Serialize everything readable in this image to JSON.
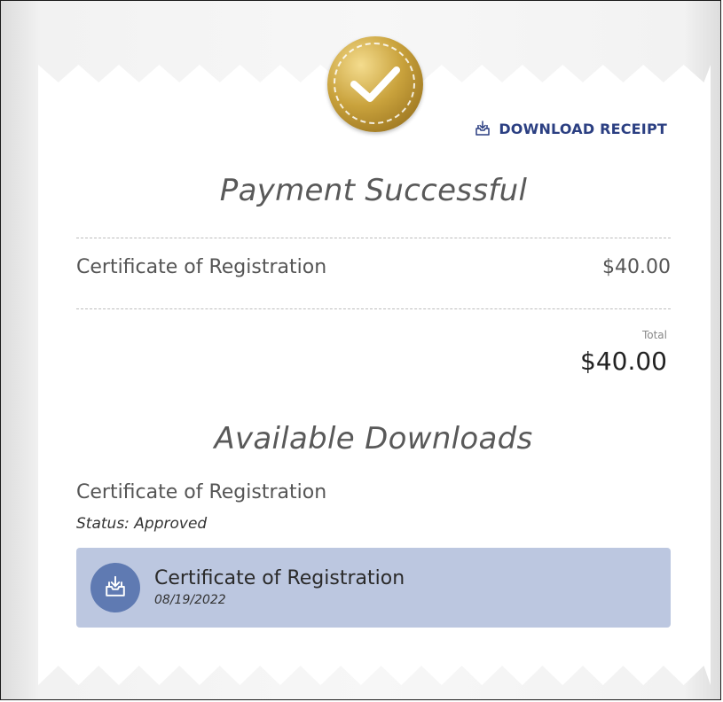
{
  "actions": {
    "download_receipt": "DOWNLOAD RECEIPT"
  },
  "payment": {
    "title": "Payment Successful",
    "items": [
      {
        "name": "Certificate of Registration",
        "price": "$40.00"
      }
    ],
    "total_label": "Total",
    "total_value": "$40.00"
  },
  "downloads": {
    "title": "Available Downloads",
    "item_name": "Certificate of Registration",
    "status": "Status: Approved",
    "files": [
      {
        "name": "Certificate of Registration",
        "date": "08/19/2022"
      }
    ]
  },
  "icons": {
    "seal": "check-seal-icon",
    "receipt": "inbox-download-icon",
    "file": "inbox-download-icon"
  },
  "colors": {
    "accent": "#2b3f82",
    "card_bg": "#bcc7e0",
    "icon_bg": "#5f7ab2",
    "gold": "#c9a23c"
  }
}
